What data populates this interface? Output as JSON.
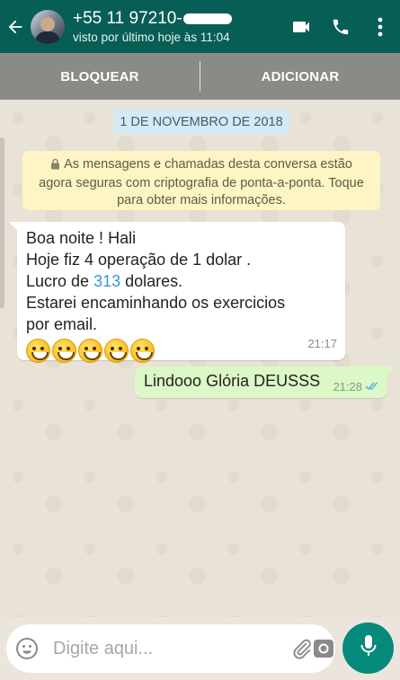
{
  "header": {
    "back_icon": "arrow-left-icon",
    "contact_name": "+55 11 97210-",
    "status": "visto por último hoje às 11:04",
    "icons": [
      "video-call-icon",
      "phone-icon",
      "more-vert-icon"
    ],
    "bg_color": "#075e54"
  },
  "actions": {
    "block_label": "BLOQUEAR",
    "add_label": "ADICIONAR"
  },
  "chat": {
    "date": "1 DE NOVEMBRO DE 2018",
    "notice": "As mensagens e chamadas desta conversa estão agora seguras com criptografia de ponta-a-ponta. Toque para obter mais informações.",
    "incoming": {
      "line1": "Boa noite ! Hali",
      "line2": "Hoje fiz 4 operação de 1 dolar .",
      "line3_prefix": "Lucro de ",
      "line3_link": "313",
      "line3_suffix": " dolares.",
      "line4": "Estarei encaminhando os exercicios",
      "line5": "por email.",
      "emoji_count": 5,
      "time": "21:17"
    },
    "outgoing": {
      "text": "Lindooo Glória DEUSSS",
      "time": "21:28",
      "status_icon": "double-check-icon"
    }
  },
  "composer": {
    "placeholder": "Digite aqui...",
    "emoji_icon": "smiley-icon",
    "attach_icon": "paperclip-icon",
    "camera_icon": "camera-icon",
    "mic_icon": "mic-icon",
    "accent_color": "#05897b"
  }
}
